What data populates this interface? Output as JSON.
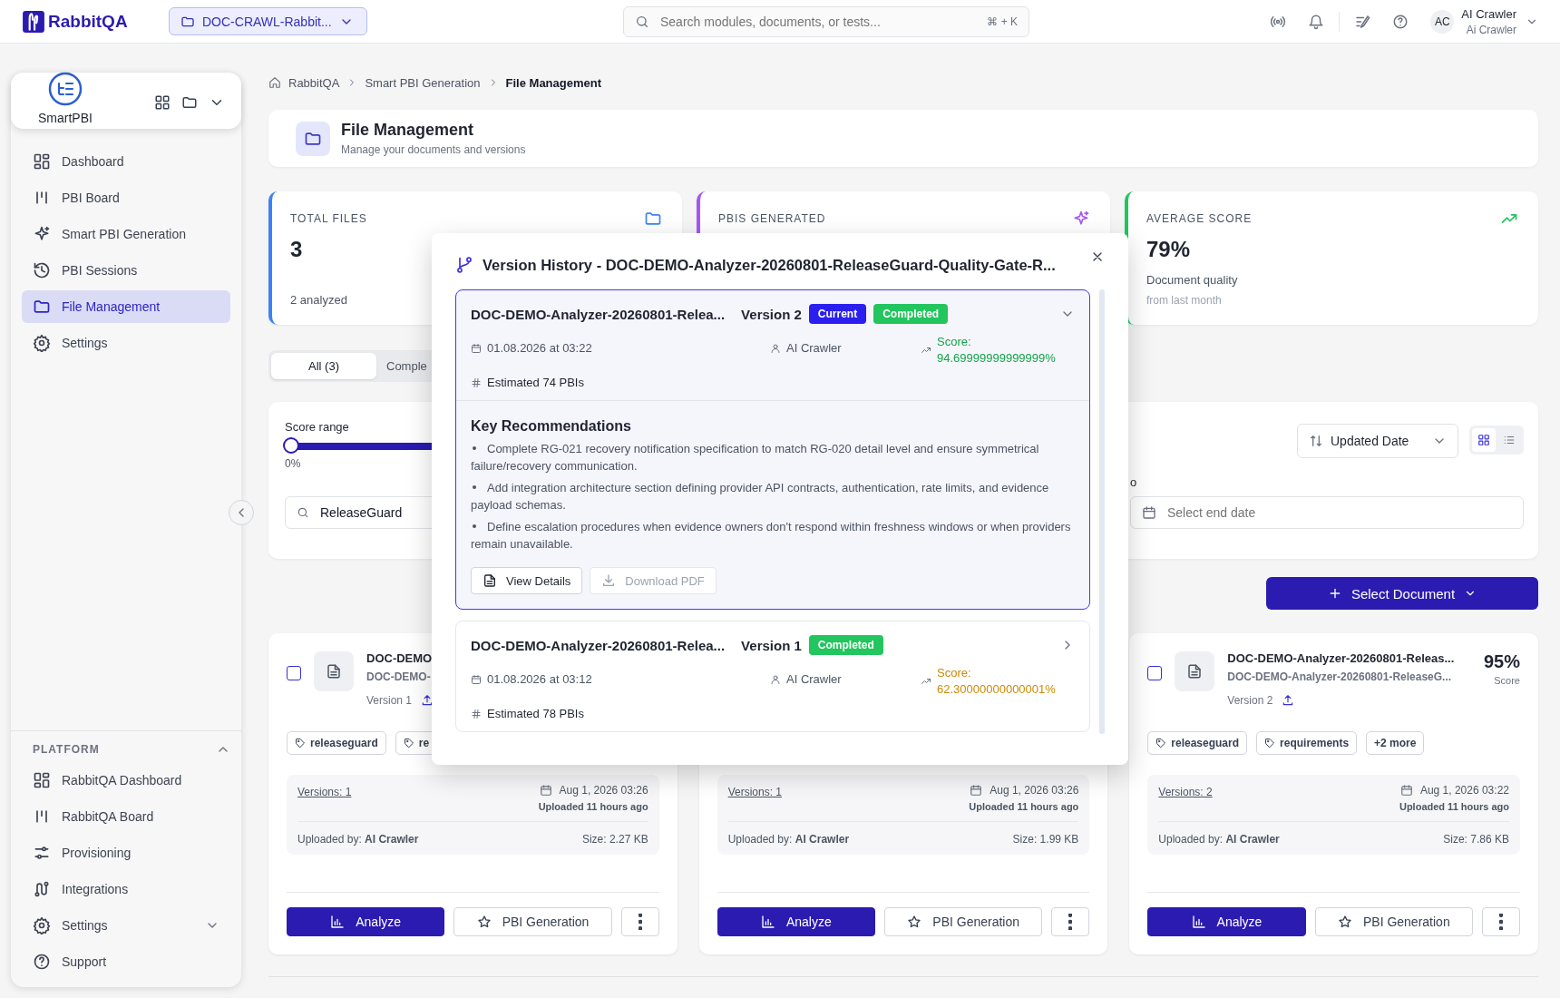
{
  "topbar": {
    "brand": "RabbitQA",
    "project": "DOC-CRAWL-Rabbit...",
    "search": {
      "placeholder": "Search modules, documents, or tests..."
    },
    "shortcut": "⌘ + K",
    "user": {
      "initials": "AC",
      "name": "AI Crawler",
      "subtitle": "Ai Crawler"
    }
  },
  "sidebar": {
    "module": "SmartPBI",
    "items": [
      {
        "label": "Dashboard",
        "selected": false
      },
      {
        "label": "PBI Board",
        "selected": false
      },
      {
        "label": "Smart PBI Generation",
        "selected": false
      },
      {
        "label": "PBI Sessions",
        "selected": false
      },
      {
        "label": "File Management",
        "selected": true
      },
      {
        "label": "Settings",
        "selected": false
      }
    ],
    "platform": {
      "title": "PLATFORM",
      "expanded": true,
      "items": [
        {
          "label": "RabbitQA Dashboard",
          "kind": "link"
        },
        {
          "label": "RabbitQA Board",
          "kind": "link"
        },
        {
          "label": "Provisioning",
          "kind": "link"
        },
        {
          "label": "Integrations",
          "kind": "link"
        },
        {
          "label": "Settings",
          "kind": "group"
        },
        {
          "label": "Support",
          "kind": "link"
        }
      ]
    }
  },
  "breadcrumb": [
    "RabbitQA",
    "Smart PBI Generation",
    "File Management"
  ],
  "header": {
    "title": "File Management",
    "subtitle": "Manage your documents and versions"
  },
  "stats": [
    {
      "label": "TOTAL FILES",
      "value": "3",
      "note": "2 analyzed",
      "color": "#3b82f6"
    },
    {
      "label": "PBIS GENERATED",
      "color": "#a855f7"
    },
    {
      "label": "AVERAGE SCORE",
      "value": "79%",
      "note": "Document quality",
      "subnote": "from last month",
      "color": "#22c55e"
    }
  ],
  "tabs": [
    {
      "label": "All (3)",
      "selected": true
    },
    {
      "label": "Comple",
      "selected": false
    }
  ],
  "filters": {
    "score_range": {
      "label": "Score range",
      "level": 0,
      "reading": "0%"
    },
    "search": {
      "value": "ReleaseGuard"
    },
    "sort": {
      "value": "Updated Date"
    },
    "view": [
      {
        "kind": "grid",
        "selected": true
      },
      {
        "kind": "list",
        "selected": false
      }
    ],
    "end_date": {
      "label": "o",
      "placeholder": "Select end date"
    }
  },
  "select_document": "Select Document",
  "documents": [
    {
      "checked": false,
      "title": "DOC-DEMO",
      "subtitle": "DOC-DEMO-",
      "version": "Version 1",
      "tags": [
        "releaseguard",
        "re"
      ],
      "versions": "Versions: 1",
      "date": "Aug 1, 2026 03:26",
      "uploaded": "Uploaded 11 hours ago",
      "uploader_label": "Uploaded by:",
      "uploader": "AI Crawler",
      "size": "Size: 2.27 KB",
      "actions": [
        "Analyze",
        "PBI Generation"
      ]
    },
    {
      "versions": "Versions: 1",
      "date": "Aug 1, 2026 03:26",
      "uploaded": "Uploaded 11 hours ago",
      "uploader_label": "Uploaded by:",
      "uploader": "AI Crawler",
      "size": "Size: 1.99 KB",
      "actions": [
        "Analyze",
        "PBI Generation"
      ]
    },
    {
      "checked": false,
      "title": "DOC-DEMO-Analyzer-20260801-Releas...",
      "subtitle": "DOC-DEMO-Analyzer-20260801-ReleaseG...",
      "score": "95%",
      "score_label": "Score",
      "version": "Version 2",
      "tags": [
        "releaseguard",
        "requirements"
      ],
      "more_tags": "+2 more",
      "versions": "Versions: 2",
      "date": "Aug 1, 2026 03:22",
      "uploaded": "Uploaded 11 hours ago",
      "uploader_label": "Uploaded by:",
      "uploader": "AI Crawler",
      "size": "Size: 7.86 KB",
      "actions": [
        "Analyze",
        "PBI Generation"
      ]
    }
  ],
  "modal": {
    "title": "Version History - DOC-DEMO-Analyzer-20260801-ReleaseGuard-Quality-Gate-R...",
    "versions": [
      {
        "name": "DOC-DEMO-Analyzer-20260801-Relea...",
        "version": "Version 2",
        "current": true,
        "current_label": "Current",
        "status": "Completed",
        "selected": true,
        "expanded": true,
        "date": "01.08.2026 at 03:22",
        "author": "AI Crawler",
        "score": "Score: 94.69999999999999%",
        "color": "#16a34a",
        "estimate": "Estimated 74 PBIs",
        "recommendations": {
          "title": "Key Recommendations",
          "items": [
            "Complete RG-021 recovery notification specification to match RG-020 detail level and ensure symmetrical failure/recovery communication.",
            "Add integration architecture section defining provider API contracts, authentication, rate limits, and evidence payload schemas.",
            "Define escalation procedures when evidence owners don't respond within freshness windows or when providers remain unavailable."
          ]
        },
        "actions": [
          {
            "label": "View Details",
            "disabled": false
          },
          {
            "label": "Download PDF",
            "disabled": true
          }
        ]
      },
      {
        "name": "DOC-DEMO-Analyzer-20260801-Relea...",
        "version": "Version 1",
        "current": false,
        "status": "Completed",
        "selected": false,
        "expanded": false,
        "date": "01.08.2026 at 03:12",
        "author": "AI Crawler",
        "score": "Score: 62.30000000000001%",
        "color": "#ca8a04",
        "estimate": "Estimated 78 PBIs"
      }
    ]
  }
}
